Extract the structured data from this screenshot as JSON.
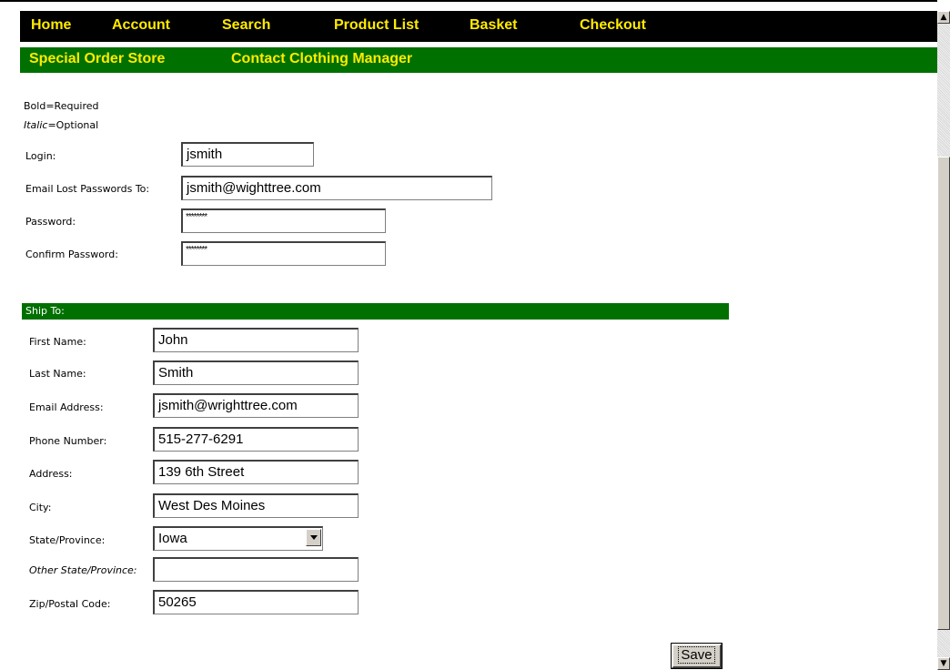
{
  "nav_primary": [
    "Home",
    "Account",
    "Search",
    "Product List",
    "Basket",
    "Checkout"
  ],
  "nav_secondary": [
    "Special Order Store",
    "Contact Clothing Manager"
  ],
  "legend": {
    "required_word": "Bold",
    "required_text": "=Required",
    "optional_word": "Italic",
    "optional_text": "=Optional"
  },
  "account": {
    "login_label": "Login:",
    "login_value": "jsmith",
    "email_lost_label": "Email Lost Passwords To:",
    "email_lost_value": "jsmith@wighttree.com",
    "password_label": "Password:",
    "password_value": "********",
    "confirm_label": "Confirm Password:",
    "confirm_value": "********"
  },
  "ship_to": {
    "header": "Ship To:",
    "first_name_label": "First Name:",
    "first_name": "John",
    "last_name_label": "Last Name:",
    "last_name": "Smith",
    "email_label": "Email Address:",
    "email": "jsmith@wrighttree.com",
    "phone_label": "Phone Number:",
    "phone": "515-277-6291",
    "address_label": "Address:",
    "address": "139 6th Street",
    "city_label": "City:",
    "city": "West Des Moines",
    "state_label": "State/Province:",
    "state": "Iowa",
    "other_state_label": "Other State/Province:",
    "other_state": "",
    "zip_label": "Zip/Postal Code:",
    "zip": "50265"
  },
  "save_label": "Save",
  "colors": {
    "nav_bg": "#000000",
    "nav_secondary_bg": "#007000",
    "nav_text": "#ffeb00",
    "section_bar": "#007000"
  }
}
